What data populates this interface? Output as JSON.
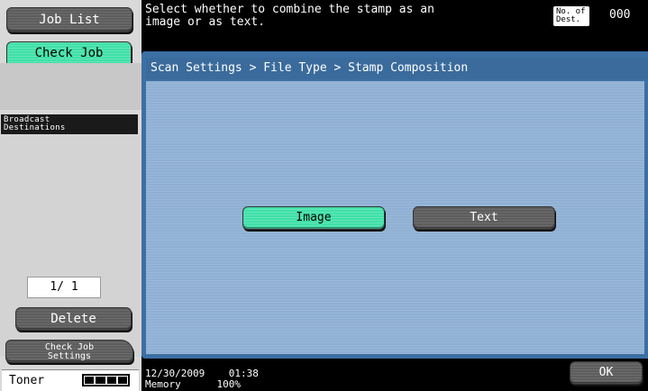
{
  "left_panel": {
    "job_list_label": "Job List",
    "check_job_label": "Check Job",
    "broadcast_destinations_label": "Broadcast\nDestinations",
    "page_count": "1/ 1",
    "delete_label": "Delete",
    "check_job_settings_label": "Check Job\nSettings",
    "toner_label": "Toner",
    "toner_level_segments": 4
  },
  "top_bar": {
    "message": "Select whether to combine the stamp as an\nimage or as text.",
    "dest_label": "No. of\nDest.",
    "dest_count": "000"
  },
  "main": {
    "breadcrumb": "Scan Settings > File Type > Stamp Composition",
    "options": [
      {
        "label": "Image",
        "selected": true
      },
      {
        "label": "Text",
        "selected": false
      }
    ]
  },
  "bottom_bar": {
    "date": "12/30/2009",
    "time": "01:38",
    "memory_label": "Memory",
    "memory_value": "100%",
    "ok_label": "OK"
  },
  "colors": {
    "accent_green": "#3fe0a8",
    "panel_blue": "#3c6fa3",
    "content_blue": "#8fb0d4",
    "button_dark": "#5d5d5d"
  }
}
